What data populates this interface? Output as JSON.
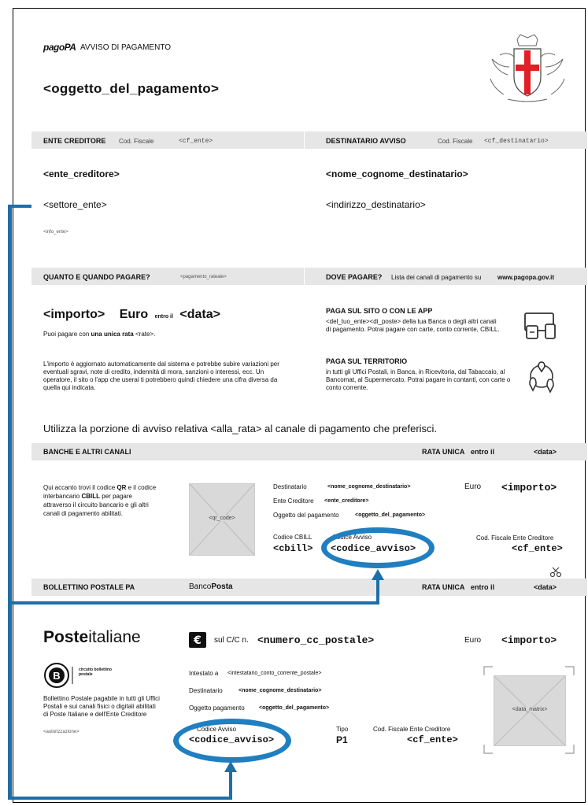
{
  "header": {
    "brand_logo": "pagoPA",
    "title": "AVVISO DI PAGAMENTO",
    "subject": "<oggetto_del_pagamento>"
  },
  "ente": {
    "label": "ENTE CREDITORE",
    "cf_label": "Cod. Fiscale",
    "cf_value": "<cf_ente>",
    "name": "<ente_creditore>",
    "sector": "<settore_ente>",
    "info": "<info_ente>"
  },
  "destinatario": {
    "label": "DESTINATARIO AVVISO",
    "cf_label": "Cod. Fiscale",
    "cf_value": "<cf_destinatario>",
    "name": "<nome_cognome_destinatario>",
    "address": "<indirizzo_destinatario>"
  },
  "quanto": {
    "label": "QUANTO E QUANDO PAGARE?",
    "rate": "<pagamento_rateale>",
    "amount": "<importo>",
    "currency": "Euro",
    "entro": "entro il",
    "date": "<data>",
    "line1_pre": "Puoi pagare con",
    "line1_bold": "una unica rata",
    "line1_post": "<rate>.",
    "note": "L'importo è aggiornato automaticamente dal sistema e potrebbe subire variazioni per eventuali sgravi, note di credito, indennità di mora, sanzioni o interessi, ecc. Un operatore, il sito o l'app che userai ti potrebbero quindi chiedere una cifra diversa da quella qui indicata."
  },
  "dove": {
    "label": "DOVE PAGARE?",
    "label_desc": "Lista dei canali di pagamento su",
    "link": "www.pagopa.gov.it",
    "sito_title": "PAGA SUL SITO O CON LE APP",
    "sito_text": "<del_tuo_ente><di_poste> della tua Banca o degli altri canali di pagamento. Potrai pagare con carte, conto corrente, CBILL.",
    "territorio_title": "PAGA SUL TERRITORIO",
    "territorio_text": "in tutti gli Uffici Postali, in Banca, in Ricevitoria, dal Tabaccaio, al Bancomat, al Supermercato. Potrai pagare in contanti, con carte o conto corrente.",
    "icon_device": "devices-icon",
    "icon_map": "location-network-icon"
  },
  "use_portion": "Utilizza la porzione di avviso relativa <alla_rata> al canale di pagamento che preferisci.",
  "banche": {
    "label": "BANCHE E ALTRI CANALI",
    "rata": "RATA UNICA",
    "entro": "entro il",
    "date": "<data>",
    "desc_pre": "Qui accanto trovi il codice",
    "desc_qr": "QR",
    "desc_mid": "e il codice interbancario",
    "desc_cbill": "CBILL",
    "desc_post": "per pagare attraverso il circuito bancario e gli altri canali di pagamento abilitati.",
    "qr": "<qr_code>",
    "dest_label": "Destinatario",
    "dest_value": "<nome_cognome_destinatario>",
    "euro": "Euro",
    "amount": "<importo>",
    "ente_label": "Ente Creditore",
    "ente_value": "<ente_creditore>",
    "oggetto_label": "Oggetto del pagamento",
    "oggetto_value": "<oggetto_del_pagamento>",
    "cbill_label": "Codice CBILL",
    "cbill_value": "<cbill>",
    "avviso_label": "Codice Avviso",
    "avviso_value": "<codice_avviso>",
    "cf_label": "Cod. Fiscale Ente Creditore",
    "cf_value": "<cf_ente>",
    "scissors": "scissors-icon"
  },
  "bollettino": {
    "label": "BOLLETTINO POSTALE PA",
    "banco": "Banco",
    "posta": "Posta",
    "rata": "RATA UNICA",
    "entro": "entro il",
    "date": "<data>",
    "poste_bold": "Poste",
    "poste_rest": "italiane",
    "circuito": "circuito bollettino postale",
    "desc": "Bollettino Postale pagabile in tutti gli Uffici Postali e sui canali fisici o digitali abilitati di Poste Italiane e dell'Ente Creditore",
    "autorizzazione": "<autorizzazione>",
    "cc_label": "sul C/C n.",
    "cc_value": "<numero_cc_postale>",
    "euro": "Euro",
    "amount": "<importo>",
    "intestato_label": "Intestato a",
    "intestato_value": "<intestatario_conto_corrente_postale>",
    "dest_label": "Destinatario",
    "dest_value": "<nome_cognome_destinatario>",
    "oggetto_label": "Oggetto pagamento",
    "oggetto_value": "<oggetto_del_pagamento>",
    "avviso_label": "Codice Avviso",
    "avviso_value": "<codice_avviso>",
    "tipo_label": "Tipo",
    "tipo_value": "P1",
    "cf_label": "Cod. Fiscale Ente Creditore",
    "cf_value": "<cf_ente>",
    "matrix": "<data_matrix>",
    "euro_icon": "euro-icon"
  },
  "colors": {
    "band": "#e6e6e6",
    "annotation": "#1f7fc1"
  }
}
